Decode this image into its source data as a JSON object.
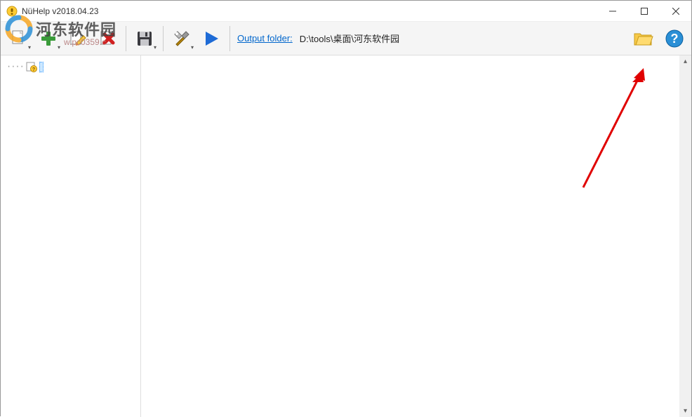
{
  "window": {
    "title": "NüHelp v2018.04.23"
  },
  "toolbar": {
    "output_label": "Output folder:",
    "output_path": "D:\\tools\\桌面\\河东软件园"
  },
  "tree": {
    "items": [
      {
        "label": ""
      }
    ]
  },
  "watermark": {
    "text": "河东软件园",
    "sub": "w.pc0359.c"
  }
}
